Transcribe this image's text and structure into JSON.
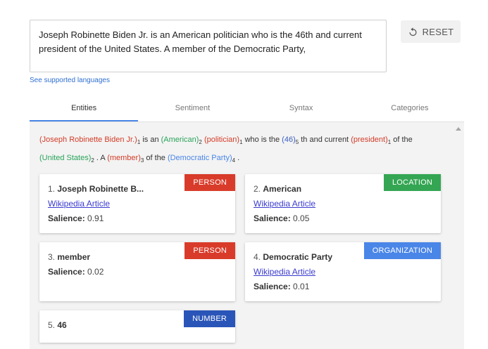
{
  "input": {
    "text": "Joseph Robinette Biden Jr. is an American politician who is the 46th and current president of the United States. A member of the Democratic Party,"
  },
  "reset_button": {
    "label": "RESET",
    "icon": "reset-icon"
  },
  "languages_link": "See supported languages",
  "tabs": [
    "Entities",
    "Sentiment",
    "Syntax",
    "Categories"
  ],
  "active_tab": "Entities",
  "annotated": {
    "t1": "(Joseph Robinette Biden Jr.)",
    "s1": "1",
    "t2": " is an ",
    "t3": "(American)",
    "s3": "2",
    "t4": " ",
    "t5": "(politician)",
    "s5": "1",
    "t6": " who is the ",
    "t7": "(46)",
    "s7": "5",
    "t8": " th and current ",
    "t9": "(president)",
    "s9": "1",
    "t10": " of the",
    "t11": "(United States)",
    "s11": "2",
    "t12": " . A ",
    "t13": "(member)",
    "s13": "3",
    "t14": " of the ",
    "t15": "(Democratic Party)",
    "s15": "4",
    "t16": " ."
  },
  "entities": [
    {
      "num": "1.",
      "name": "Joseph Robinette B...",
      "type": "PERSON",
      "type_color": "#d93b2a",
      "link": "Wikipedia Article",
      "salience_label": "Salience:",
      "salience": "0.91"
    },
    {
      "num": "2.",
      "name": "American",
      "type": "LOCATION",
      "type_color": "#34a653",
      "link": "Wikipedia Article",
      "salience_label": "Salience:",
      "salience": "0.05"
    },
    {
      "num": "3.",
      "name": "member",
      "type": "PERSON",
      "type_color": "#d93b2a",
      "salience_label": "Salience:",
      "salience": "0.02"
    },
    {
      "num": "4.",
      "name": "Democratic Party",
      "type": "ORGANIZATION",
      "type_color": "#4a86e8",
      "link": "Wikipedia Article",
      "salience_label": "Salience:",
      "salience": "0.01"
    },
    {
      "num": "5.",
      "name": "46",
      "type": "NUMBER",
      "type_color": "#2a55b8"
    }
  ]
}
